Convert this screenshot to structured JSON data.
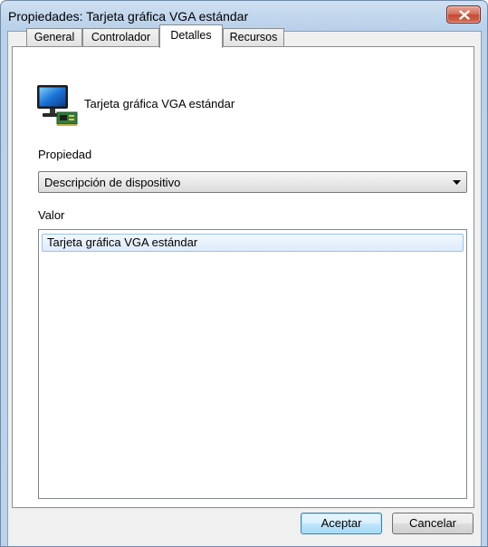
{
  "window": {
    "title": "Propiedades: Tarjeta gráfica VGA estándar",
    "close_icon": "close-x-icon"
  },
  "tabs": [
    {
      "label": "General",
      "active": false
    },
    {
      "label": "Controlador",
      "active": false
    },
    {
      "label": "Detalles",
      "active": true
    },
    {
      "label": "Recursos",
      "active": false
    }
  ],
  "device": {
    "icon": "display-adapter-icon",
    "name": "Tarjeta gráfica VGA estándar"
  },
  "property": {
    "label": "Propiedad",
    "selected": "Descripción de dispositivo"
  },
  "value": {
    "label": "Valor",
    "items": [
      "Tarjeta gráfica VGA estándar"
    ]
  },
  "buttons": {
    "ok": "Aceptar",
    "cancel": "Cancelar"
  }
}
